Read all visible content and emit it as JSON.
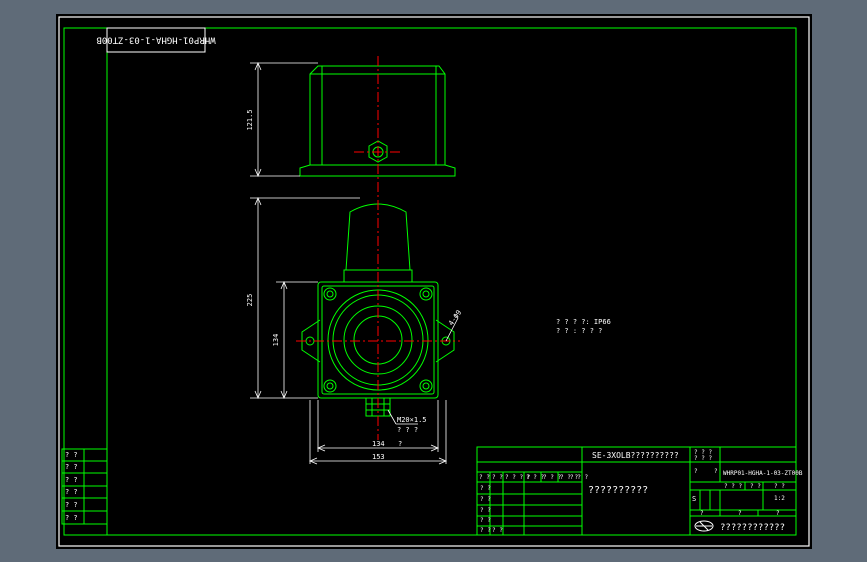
{
  "colors": {
    "background": "#5f6b78",
    "paper": "#000000",
    "frame": "#ffffff",
    "linework": "#00ff00",
    "centerline": "#ff0000",
    "text": "#ffffff"
  },
  "drawing_code_stamp": "WHRP01-HGHA-1-03-ZT00B",
  "dimensions": {
    "top_height": "121.5",
    "overall_height": "225",
    "body_height": "134",
    "angle": "4-Φ9",
    "thread_line1": "M20×1.5",
    "thread_line2": "? ? ?",
    "width_inner": "134",
    "width_inner_suffix": "?",
    "width_outer": "153"
  },
  "notes": {
    "line1": "? ? ? ?: IP66",
    "line2": "? ? : ? ? ?"
  },
  "left_table": {
    "rows": [
      "? ?",
      "? ?",
      "? ?",
      "? ?",
      "? ?",
      "? ?"
    ]
  },
  "title_block": {
    "part_title": "SE-3XOLB??????????",
    "drawing_name": "??????????",
    "drawing_code": "WHRP01-HGHA-1-03-ZT00B",
    "company": "????????????",
    "scale": "1:2",
    "top_labels": [
      "? ? ?",
      "? ? ?"
    ],
    "code_labels": [
      "?",
      "?"
    ],
    "sheet_label": "S",
    "stage_labels": [
      "? ? ?",
      "? ?",
      "? ?"
    ],
    "sheet_cells": [
      "?",
      "?",
      "?"
    ],
    "rev_header": [
      "? ?",
      "? ?",
      "? ? ? ?",
      "? ? ?",
      "? ? ?",
      "? ? ?",
      "? ? ?"
    ],
    "sign_rows": [
      "? ?",
      "? ?",
      "? ?",
      "? ?",
      "? ?",
      "? ?"
    ]
  }
}
